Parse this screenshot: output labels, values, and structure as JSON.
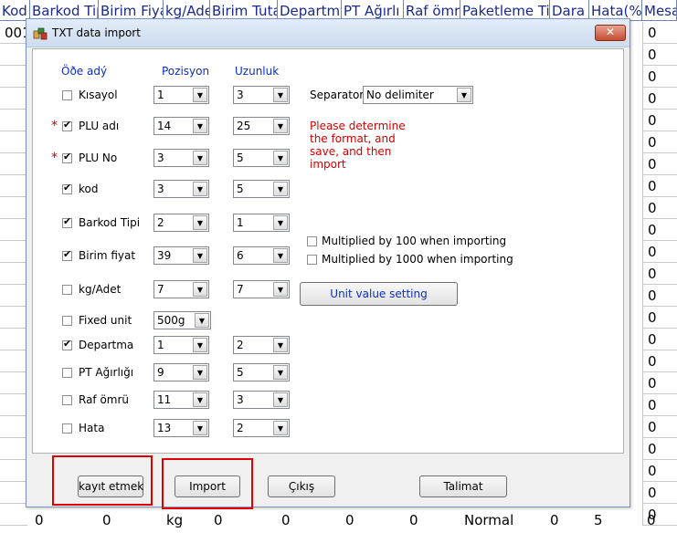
{
  "sheet": {
    "headers": [
      "Kod",
      "Barkod Tip",
      "Birim Fiyat",
      "kg/Ade",
      "Birim Tuta",
      "Departma",
      "PT Ağırlı",
      "Raf ömrü",
      "Paketleme Ti",
      "Dara",
      "Hata(%",
      "Mesa"
    ],
    "left_cells": [
      "001",
      "",
      "",
      "",
      "",
      "",
      "",
      "",
      "",
      "",
      "",
      "",
      "",
      "",
      "",
      "",
      "",
      "",
      "",
      "",
      "",
      "",
      ""
    ],
    "right_cells": [
      "0",
      "0",
      "0",
      "0",
      "0",
      "0",
      "0",
      "0",
      "0",
      "0",
      "0",
      "0",
      "0",
      "0",
      "0",
      "0",
      "0",
      "0",
      "0",
      "0",
      "0",
      "0",
      "0"
    ],
    "bottom_row": [
      "0",
      "0",
      "kg",
      "0",
      "0",
      "0",
      "0",
      "Normal",
      "0",
      "5",
      "0"
    ]
  },
  "dialog": {
    "title": "TXT data import",
    "close_glyph": "✕",
    "col_name": "Öðe adý",
    "col_position": "Pozisyon",
    "col_length": "Uzunluk",
    "star_glyph": "*",
    "check_glyph": "✔",
    "arrow_glyph": "▼",
    "fields": [
      {
        "label": "Kısayol",
        "checked": false,
        "required": false,
        "pos": "1",
        "len": "3"
      },
      {
        "label": "PLU adı",
        "checked": true,
        "required": true,
        "pos": "14",
        "len": "25"
      },
      {
        "label": "PLU No",
        "checked": true,
        "required": true,
        "pos": "3",
        "len": "5"
      },
      {
        "label": "kod",
        "checked": true,
        "required": false,
        "pos": "3",
        "len": "5"
      },
      {
        "label": "Barkod Tipi",
        "checked": true,
        "required": false,
        "pos": "2",
        "len": "1"
      },
      {
        "label": "Birim fiyat",
        "checked": true,
        "required": false,
        "pos": "39",
        "len": "6"
      },
      {
        "label": "kg/Adet",
        "checked": false,
        "required": false,
        "pos": "7",
        "len": "7"
      },
      {
        "label": "Fixed unit",
        "checked": false,
        "required": false,
        "pos": "500g",
        "len": null
      },
      {
        "label": "Departma",
        "checked": true,
        "required": false,
        "pos": "1",
        "len": "2"
      },
      {
        "label": "PT Ağırlığı",
        "checked": false,
        "required": false,
        "pos": "9",
        "len": "5"
      },
      {
        "label": "Raf ömrü",
        "checked": false,
        "required": false,
        "pos": "11",
        "len": "3"
      },
      {
        "label": "Hata",
        "checked": false,
        "required": false,
        "pos": "13",
        "len": "2"
      }
    ],
    "separator_label": "Separator",
    "separator_value": "No delimiter",
    "note_lines": [
      "Please determine",
      "the format, and",
      "save, and then",
      "import"
    ],
    "multiply100_label": "Multiplied by 100 when importing",
    "multiply1000_label": "Multiplied by 1000 when importing",
    "unit_value_button": "Unit value setting",
    "buttons": {
      "save": "kayıt etmek",
      "import": "Import",
      "exit": "Çıkış",
      "instruction": "Talimat"
    }
  }
}
